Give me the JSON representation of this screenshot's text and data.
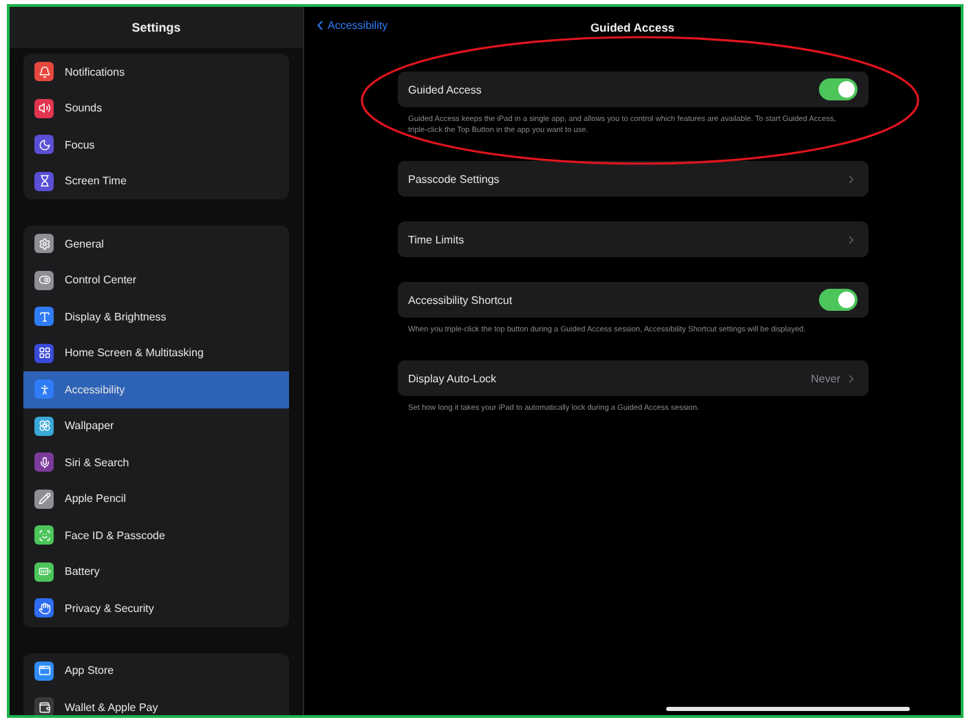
{
  "sidebar": {
    "title": "Settings",
    "groups": [
      {
        "items": [
          {
            "label": "Notifications",
            "color": "#e5473d",
            "selected": false
          },
          {
            "label": "Sounds",
            "color": "#e2344f",
            "selected": false
          },
          {
            "label": "Focus",
            "color": "#5b4fd6",
            "selected": false
          },
          {
            "label": "Screen Time",
            "color": "#5b4fd6",
            "selected": false
          }
        ]
      },
      {
        "items": [
          {
            "label": "General",
            "color": "#8e8e93",
            "selected": false
          },
          {
            "label": "Control Center",
            "color": "#8e8e93",
            "selected": false
          },
          {
            "label": "Display & Brightness",
            "color": "#2f7cf6",
            "selected": false
          },
          {
            "label": "Home Screen & Multitasking",
            "color": "#3a4bd8",
            "selected": false
          },
          {
            "label": "Accessibility",
            "color": "#2f7cf6",
            "selected": true
          },
          {
            "label": "Wallpaper",
            "color": "#3aa8d8",
            "selected": false
          },
          {
            "label": "Siri & Search",
            "color": "#7a3b9a",
            "selected": false
          },
          {
            "label": "Apple Pencil",
            "color": "#8e8e93",
            "selected": false
          },
          {
            "label": "Face ID & Passcode",
            "color": "#4cc55a",
            "selected": false
          },
          {
            "label": "Battery",
            "color": "#4cc55a",
            "selected": false
          },
          {
            "label": "Privacy & Security",
            "color": "#2f6cf0",
            "selected": false
          }
        ]
      },
      {
        "items": [
          {
            "label": "App Store",
            "color": "#2f8cf6",
            "selected": false
          },
          {
            "label": "Wallet & Apple Pay",
            "color": "#3a3a3c",
            "selected": false
          }
        ]
      }
    ]
  },
  "detail": {
    "back": "Accessibility",
    "title": "Guided Access",
    "sections": [
      {
        "kind": "toggle",
        "label": "Guided Access",
        "on": true,
        "footer": "Guided Access keeps the iPad in a single app, and allows you to control which features are available. To start Guided Access, triple-click the Top Button in the app you want to use."
      },
      {
        "kind": "link",
        "label": "Passcode Settings"
      },
      {
        "kind": "link",
        "label": "Time Limits"
      },
      {
        "kind": "toggle",
        "label": "Accessibility Shortcut",
        "on": true,
        "footer": "When you triple-click the top button during a Guided Access session, Accessibility Shortcut settings will be displayed."
      },
      {
        "kind": "value",
        "label": "Display Auto-Lock",
        "value": "Never",
        "footer": "Set how long it takes your iPad to automatically lock during a Guided Access session."
      }
    ]
  }
}
